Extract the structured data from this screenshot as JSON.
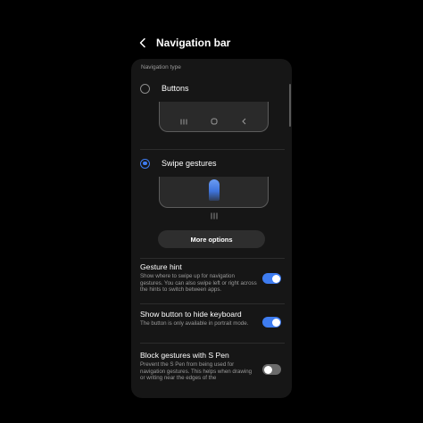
{
  "header": {
    "title": "Navigation bar",
    "back_icon": "chevron-left-icon"
  },
  "navigation_type": {
    "section_label": "Navigation type",
    "options": [
      {
        "label": "Buttons",
        "selected": false
      },
      {
        "label": "Swipe gestures",
        "selected": true
      }
    ],
    "buttons_preview_icons": [
      "recents-icon",
      "home-icon",
      "back-icon"
    ],
    "gestures_preview_icon": "swipe-hint-icon"
  },
  "more_options": {
    "label": "More options"
  },
  "settings": [
    {
      "title": "Gesture hint",
      "description": "Show where to swipe up for navigation gestures. You can also swipe left or right across the hints to switch between apps.",
      "enabled": true
    },
    {
      "title": "Show button to hide keyboard",
      "description": "The button is only available in portrait mode.",
      "enabled": true
    },
    {
      "title": "Block gestures with S Pen",
      "description": "Prevent the S Pen from being used for navigation gestures. This helps when drawing or writing near the edges of the",
      "enabled": false
    }
  ],
  "colors": {
    "accent": "#3e7cf0",
    "background": "#000000",
    "card": "#161616",
    "toggle_off": "#6a6a6a"
  }
}
